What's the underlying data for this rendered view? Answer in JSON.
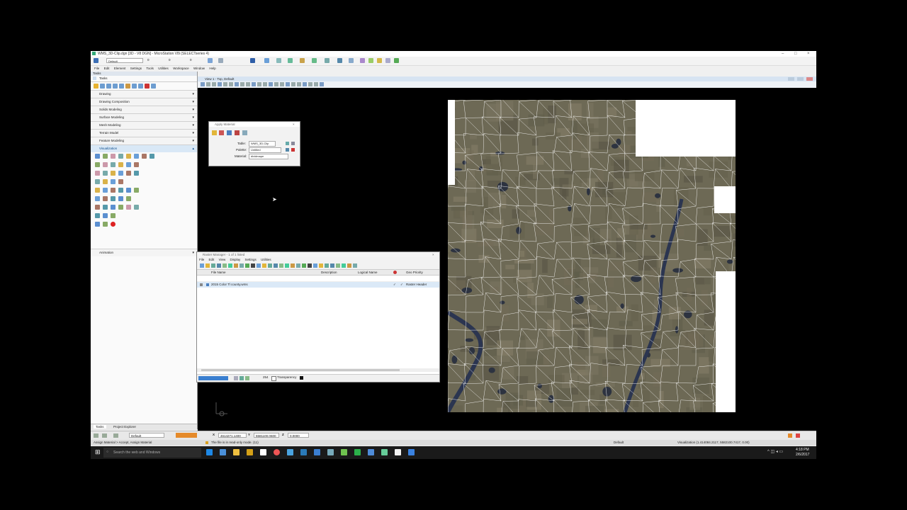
{
  "window": {
    "title": "WMS_3D-Clip.dgn [3D - V8 DGN] - MicroStation V8i (SELECTseries 4)",
    "controls": [
      "–",
      "□",
      "×"
    ]
  },
  "toolbar": {
    "level_dropdown": "Default",
    "spin1": "0",
    "spin2": "0",
    "spin3": "0"
  },
  "menu": [
    "File",
    "Edit",
    "Element",
    "Settings",
    "Tools",
    "Utilities",
    "Workspace",
    "Window",
    "Help"
  ],
  "tasks_panel": {
    "title": "Tasks",
    "root": "Tasks",
    "sections": [
      {
        "label": "Drawing"
      },
      {
        "label": "Drawing Composition"
      },
      {
        "label": "Solids Modeling"
      },
      {
        "label": "Surface Modeling"
      },
      {
        "label": "Mesh Modeling"
      },
      {
        "label": "Terrain Model"
      },
      {
        "label": "Feature Modeling"
      },
      {
        "label": "Visualization",
        "active": true
      }
    ],
    "animation": "Animation",
    "tabs": [
      "Tasks",
      "Project Explorer"
    ]
  },
  "view": {
    "title": "View 1 - Top, Default"
  },
  "apply_material": {
    "title": "Apply Material",
    "table_label": "Table:",
    "table_value": "WMS_3D-Clip",
    "palette_label": "Palette:",
    "palette_value": "Untitled",
    "material_label": "Material:",
    "material_value": "dividmape"
  },
  "raster_manager": {
    "title": "Raster Manager - 1 of 1 listed",
    "menu": [
      "File",
      "Edit",
      "View",
      "Display",
      "Settings",
      "Utilities"
    ],
    "columns": [
      "File Name",
      "Description",
      "Logical Name",
      "",
      "Geo Priority"
    ],
    "rows": [
      {
        "file": "2015 Color Tl county.wms",
        "desc": "",
        "logical": "",
        "check1": "✓",
        "check2": "✓",
        "priority": "Raster Header"
      }
    ],
    "bottom_label": "Transparency",
    "bottom_value": "254"
  },
  "status": {
    "x_label": "X",
    "x_value": "4614271.1400",
    "y_label": "Y",
    "y_value": "5581100.0600",
    "z_label": "Z",
    "z_value": "0.0000",
    "level": "Default",
    "dropdown": "Default",
    "message_left": "Assign Material > Accept, Assign Material",
    "message_mid": "The file is in read-only mode. (11)",
    "message_right": "Default",
    "coords_right": "Visualization (1.414084.2117, 5582100.7417, 0.00)"
  },
  "taskbar": {
    "search": "Search the web and Windows",
    "time": "4:18 PM",
    "date": "2/6/2017"
  },
  "colors": {
    "accent": "#2b6cb0",
    "map_bg": "#6f6a56",
    "grid": "#ffffff"
  }
}
